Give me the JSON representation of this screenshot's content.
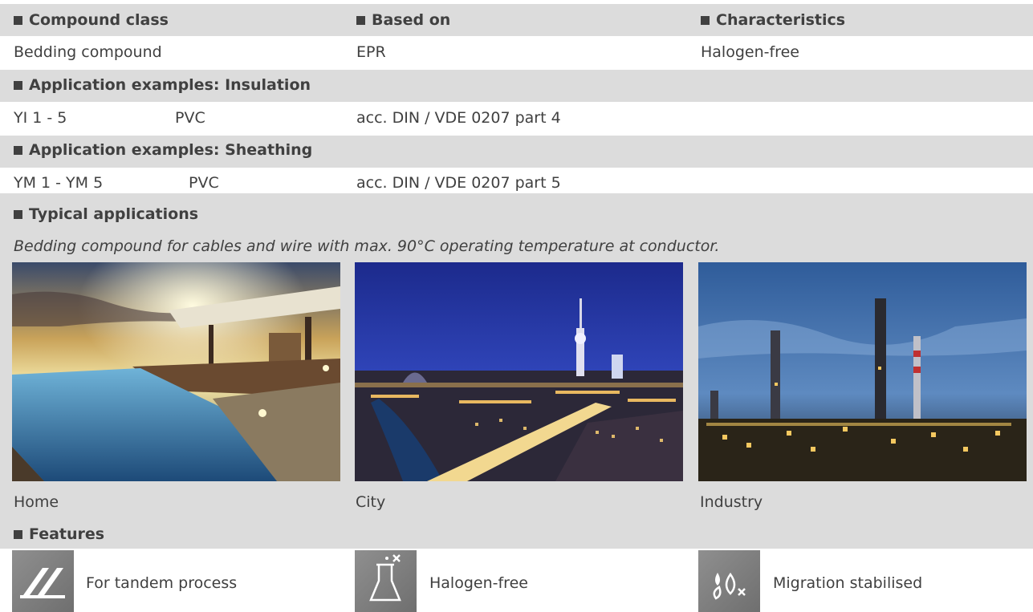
{
  "compound_class": {
    "label": "Compound class",
    "value": "Bedding compound"
  },
  "based_on": {
    "label": "Based on",
    "value": "EPR"
  },
  "characteristics": {
    "label": "Characteristics",
    "value": "Halogen-free"
  },
  "insulation": {
    "label_prefix": "Application examples",
    "label_suffix": ": Insulation",
    "row": {
      "type": "YI 1 - 5",
      "material": "PVC",
      "standard": "acc. DIN / VDE 0207 part 4"
    }
  },
  "sheathing": {
    "label_prefix": "Application examples",
    "label_suffix": ": Sheathing",
    "row": {
      "type": "YM 1 - YM 5",
      "material": "PVC",
      "standard": "acc. DIN / VDE 0207 part 5"
    }
  },
  "typical": {
    "label": "Typical applications",
    "description": "Bedding compound for cables and wire with max. 90°C operating temperature at conductor."
  },
  "photos": [
    {
      "caption": "Home",
      "icon": "home-pool-photo"
    },
    {
      "caption": "City",
      "icon": "city-night-photo"
    },
    {
      "caption": "Industry",
      "icon": "industry-plant-photo"
    }
  ],
  "features": {
    "label": "Features",
    "items": [
      {
        "label": "For tandem process",
        "icon": "tandem-process-icon"
      },
      {
        "label": "Halogen-free",
        "icon": "halogen-free-flask-icon"
      },
      {
        "label": "Migration stabilised",
        "icon": "migration-drops-icon"
      }
    ]
  },
  "colors": {
    "text": "#404040",
    "shaded_band": "#dcdcdc",
    "icon_tile": "#7f7f7f"
  }
}
